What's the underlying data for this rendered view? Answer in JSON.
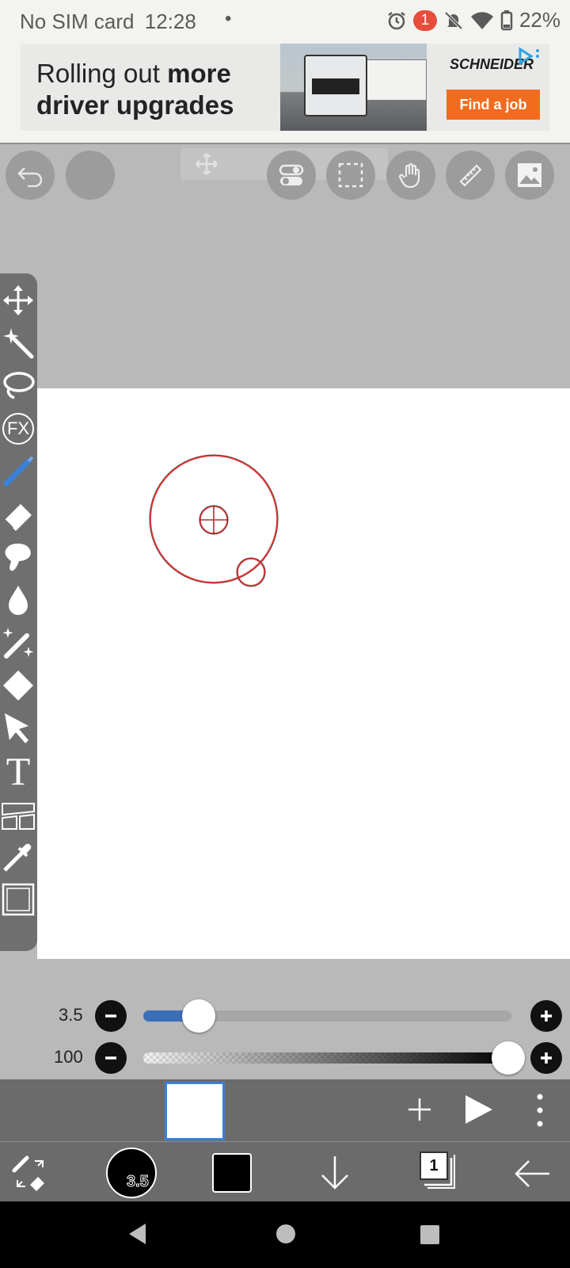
{
  "status_bar": {
    "carrier": "No SIM card",
    "time": "12:28",
    "dot": "•",
    "notification_count": "1",
    "battery": "22%"
  },
  "ad": {
    "line1_normal": "Rolling out ",
    "line1_bold": "more",
    "line2_bold": "driver upgrades",
    "brand": "SCHNEIDER",
    "cta": "Find a job"
  },
  "toolbar": {
    "icons": [
      "undo-icon",
      "redo-icon",
      "move-icon",
      "toggle-icon",
      "selection-icon",
      "hand-icon",
      "ruler-icon",
      "image-icon"
    ]
  },
  "tools": [
    "move-icon",
    "magic-wand-icon",
    "lasso-icon",
    "fx-icon",
    "brush-icon",
    "eraser-icon",
    "smudge-icon",
    "blur-icon",
    "sparkle-brush-icon",
    "fill-icon",
    "select-arrow-icon",
    "text-icon",
    "frame-divider-icon",
    "eyedropper-icon",
    "canvas-icon"
  ],
  "tool_fx_label": "FX",
  "tool_text_label": "T",
  "brush": {
    "size_label": "3.5",
    "size_fraction": 0.12,
    "opacity_label": "100",
    "opacity_fraction": 1.0,
    "cursor_color": "#e53935"
  },
  "bottom": {
    "brush_size": "3.5",
    "color": "#000000",
    "layer_count": "1"
  },
  "accent_color": "#3b80d9"
}
